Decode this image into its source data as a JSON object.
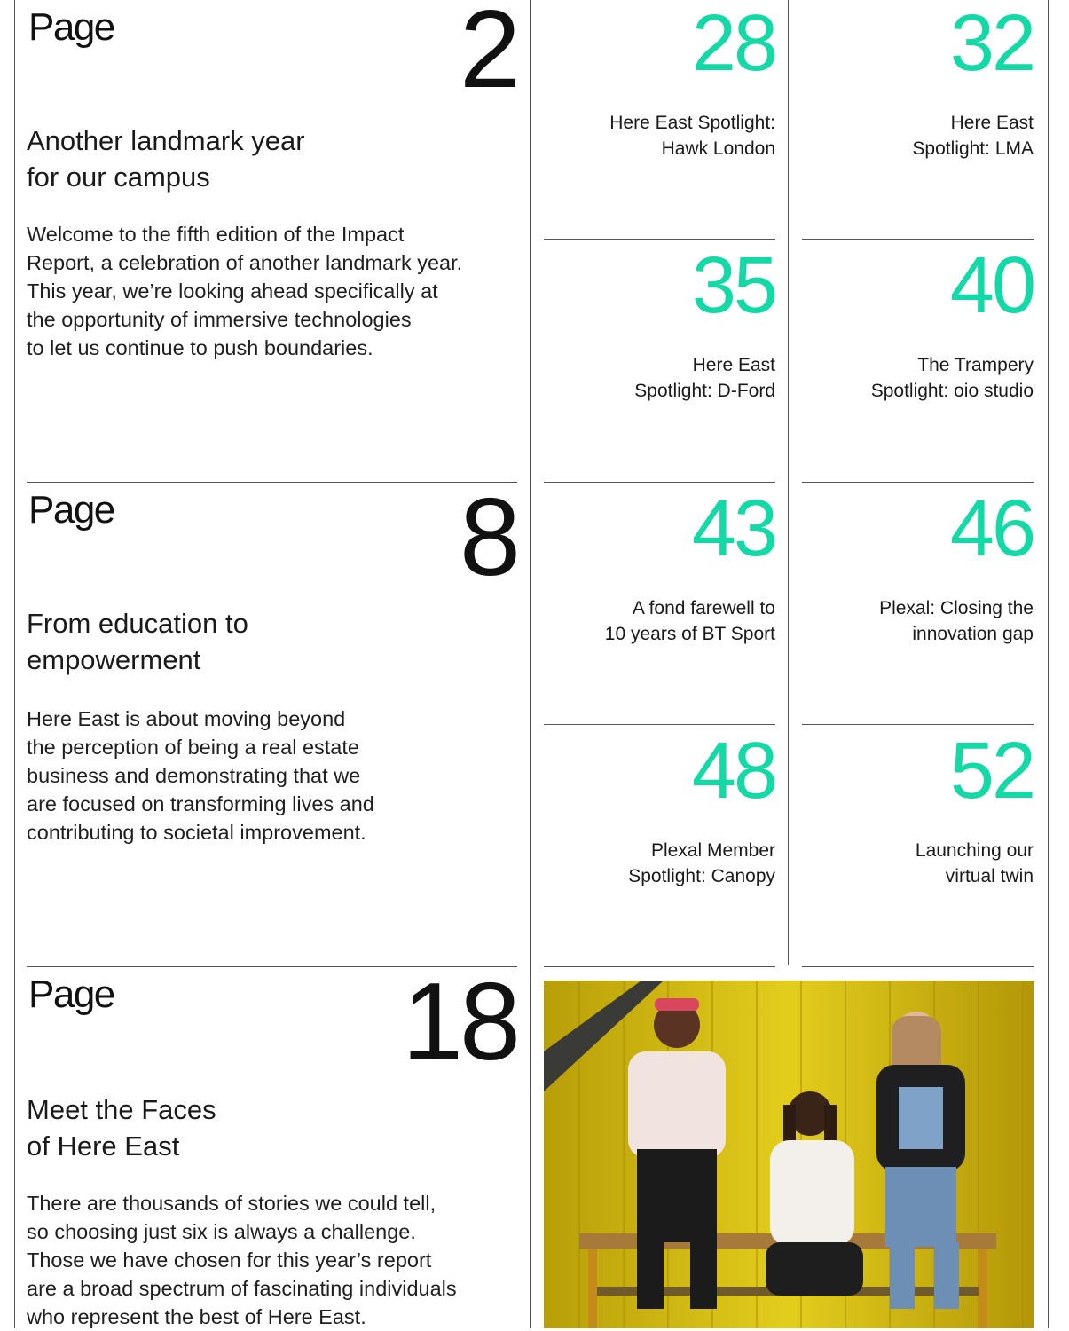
{
  "left_entries": [
    {
      "page_word": "Page",
      "page_number": "2",
      "title_lines": [
        "Another landmark year",
        "for our campus"
      ],
      "body_lines": [
        "Welcome to the fifth edition of the Impact",
        "Report, a celebration of another landmark year.",
        "This year, we’re looking ahead specifically at",
        "the opportunity of immersive technologies",
        "to let us continue to push boundaries."
      ]
    },
    {
      "page_word": "Page",
      "page_number": "8",
      "title_lines": [
        "From education to",
        "empowerment"
      ],
      "body_lines": [
        "Here East is about moving beyond",
        "the perception of being a real estate",
        "business and demonstrating that we",
        "are focused on transforming lives and",
        "contributing to societal improvement."
      ]
    },
    {
      "page_word": "Page",
      "page_number": "18",
      "title_lines": [
        "Meet the Faces",
        "of Here East"
      ],
      "body_lines": [
        "There are thousands of stories we could tell,",
        "so choosing just six is always a challenge.",
        "Those we have chosen for this year’s report",
        "are a broad spectrum of fascinating individuals",
        "who represent the best of Here East."
      ]
    }
  ],
  "grid": [
    {
      "number": "28",
      "label_lines": [
        "Here East Spotlight:",
        "Hawk London"
      ]
    },
    {
      "number": "32",
      "label_lines": [
        "Here East",
        "Spotlight: LMA"
      ]
    },
    {
      "number": "35",
      "label_lines": [
        "Here East",
        "Spotlight: D-Ford"
      ]
    },
    {
      "number": "40",
      "label_lines": [
        "The Trampery",
        "Spotlight: oio studio"
      ]
    },
    {
      "number": "43",
      "label_lines": [
        "A fond farewell to",
        "10 years of BT Sport"
      ]
    },
    {
      "number": "46",
      "label_lines": [
        "Plexal: Closing the",
        "innovation gap"
      ]
    },
    {
      "number": "48",
      "label_lines": [
        "Plexal Member",
        "Spotlight: Canopy"
      ]
    },
    {
      "number": "52",
      "label_lines": [
        "Launching our",
        "virtual twin"
      ]
    }
  ],
  "colors": {
    "accent": "#12d9a6",
    "photo_background": "#c9b10e"
  }
}
